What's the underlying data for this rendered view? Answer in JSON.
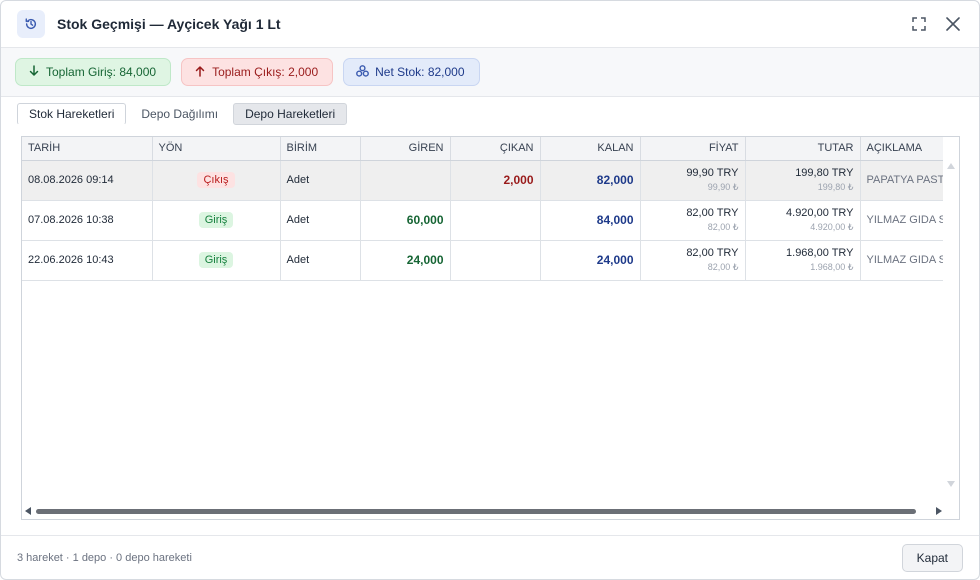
{
  "dialog": {
    "title": "Stok Geçmişi — Ayçicek Yağı 1 Lt",
    "title_icon": "history-icon",
    "maximize_icon": "maximize-icon",
    "close_icon": "close-icon"
  },
  "summary": {
    "total_in": "Toplam Giriş: 84,000",
    "total_out": "Toplam Çıkış: 2,000",
    "net": "Net Stok: 82,000"
  },
  "tabs": [
    {
      "label": "Stok Hareketleri"
    },
    {
      "label": "Depo Dağılımı"
    },
    {
      "label": "Depo Hareketleri"
    }
  ],
  "table": {
    "headers": [
      "TARİH",
      "YÖN",
      "BİRİM",
      "GİREN",
      "ÇIKAN",
      "KALAN",
      "FİYAT",
      "TUTAR",
      "AÇIKLAMA"
    ],
    "rows": [
      {
        "date": "08.08.2026 09:14",
        "dir": "Çıkış",
        "unit": "Adet",
        "in": "",
        "out": "2,000",
        "bal": "82,000",
        "price": "99,90 TRY",
        "price_sub": "99,90 ₺",
        "total": "199,80 TRY",
        "total_sub": "199,80 ₺",
        "desc": "PAPATYA PASTANESİ"
      },
      {
        "date": "07.08.2026 10:38",
        "dir": "Giriş",
        "unit": "Adet",
        "in": "60,000",
        "out": "",
        "bal": "84,000",
        "price": "82,00 TRY",
        "price_sub": "82,00 ₺",
        "total": "4.920,00 TRY",
        "total_sub": "4.920,00 ₺",
        "desc": "YILMAZ GIDA SAN."
      },
      {
        "date": "22.06.2026 10:43",
        "dir": "Giriş",
        "unit": "Adet",
        "in": "24,000",
        "out": "",
        "bal": "24,000",
        "price": "82,00 TRY",
        "price_sub": "82,00 ₺",
        "total": "1.968,00 TRY",
        "total_sub": "1.968,00 ₺",
        "desc": "YILMAZ GIDA SAN."
      }
    ]
  },
  "footer": {
    "status": "3 hareket · 1 depo · 0 depo hareketi",
    "close_label": "Kapat"
  },
  "colors": {
    "in": "#166534",
    "out": "#991b1b",
    "balance": "#1e3a8a"
  }
}
